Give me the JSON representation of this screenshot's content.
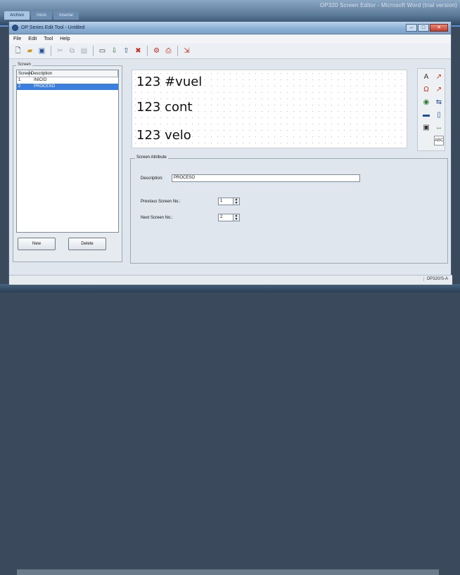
{
  "background": {
    "title": "OP320 Screen Editor - Microsoft Word (trial version)",
    "tabs": [
      "Archivo",
      "Inicio",
      "Insertar"
    ]
  },
  "app": {
    "title": "OP Series Edit Tool - Untitled",
    "menu": [
      "File",
      "Edit",
      "Tool",
      "Help"
    ],
    "toolbar_icons": [
      "new-file-icon",
      "open-folder-icon",
      "save-icon",
      "cut-icon",
      "copy-icon",
      "paste-icon",
      "window-icon",
      "download-icon",
      "upload-icon",
      "delete-icon",
      "tools-icon",
      "print-icon",
      "exit-icon"
    ]
  },
  "screen_list": {
    "caption": "Screen",
    "col_num": "Screen",
    "col_desc": "Description",
    "rows": [
      {
        "num": "1",
        "desc": "INICIO"
      },
      {
        "num": "2",
        "desc": "PROCESO"
      }
    ],
    "new_label": "New",
    "delete_label": "Delete"
  },
  "display": {
    "lines": [
      "123 #vuel",
      "123 cont",
      "123 velo"
    ]
  },
  "palette": {
    "items": [
      "A",
      "↗",
      "Ω",
      "↗",
      "◉",
      "⇆",
      "▬",
      "▯",
      "▣",
      "↔",
      "ABC"
    ]
  },
  "attributes": {
    "caption": "Screen Attribute",
    "description_label": "Description:",
    "description_value": "PROCESO",
    "prev_label": "Previous Screen No.:",
    "prev_value": "1",
    "next_label": "Next Screen No.:",
    "next_value": "2"
  },
  "status": {
    "model": "OP320/S-A"
  }
}
